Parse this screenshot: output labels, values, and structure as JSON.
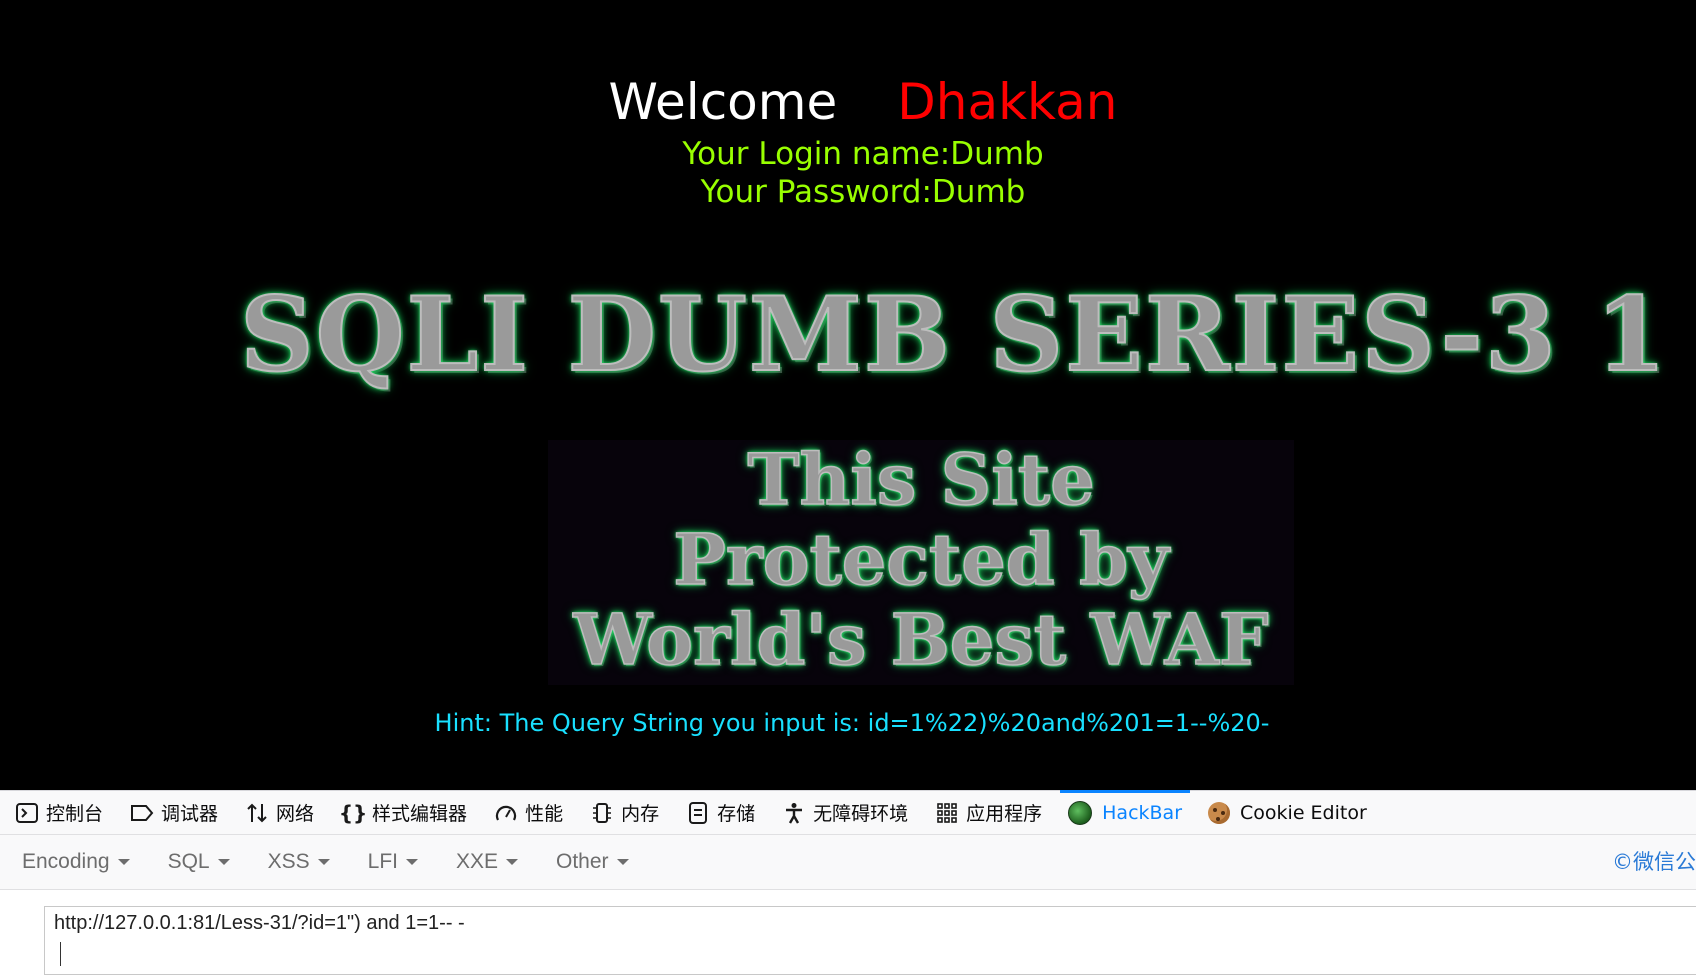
{
  "page": {
    "welcome": "Welcome",
    "username": "Dhakkan",
    "login_line": "Your Login name:Dumb",
    "password_line": "Your Password:Dumb",
    "banner": "SQLI DUMB SERIES-3 1",
    "waf_lines": [
      "This Site",
      "Protected by",
      "World's Best WAF"
    ],
    "hint": "Hint: The Query String you input is: id=1%22)%20and%201=1--%20-"
  },
  "devtools": {
    "tabs": [
      {
        "label": "控制台",
        "icon": "console-icon"
      },
      {
        "label": "调试器",
        "icon": "debugger-icon"
      },
      {
        "label": "网络",
        "icon": "network-icon"
      },
      {
        "label": "样式编辑器",
        "icon": "style-editor-icon"
      },
      {
        "label": "性能",
        "icon": "performance-icon"
      },
      {
        "label": "内存",
        "icon": "memory-icon"
      },
      {
        "label": "存储",
        "icon": "storage-icon"
      },
      {
        "label": "无障碍环境",
        "icon": "accessibility-icon"
      },
      {
        "label": "应用程序",
        "icon": "application-icon"
      },
      {
        "label": "HackBar",
        "icon": "hackbar-icon",
        "active": true
      },
      {
        "label": "Cookie Editor",
        "icon": "cookie-icon"
      }
    ],
    "active_color": "#0a84ff"
  },
  "hackbar": {
    "menu": [
      "Encoding",
      "SQL",
      "XSS",
      "LFI",
      "XXE",
      "Other"
    ],
    "right_text": "©微信公",
    "url_value": "http://127.0.0.1:81/Less-31/?id=1\") and 1=1-- -"
  },
  "colors": {
    "background": "#000000",
    "welcome": "#ffffff",
    "username": "#ff0000",
    "credentials": "#99ff00",
    "hint": "#19e0ff"
  }
}
